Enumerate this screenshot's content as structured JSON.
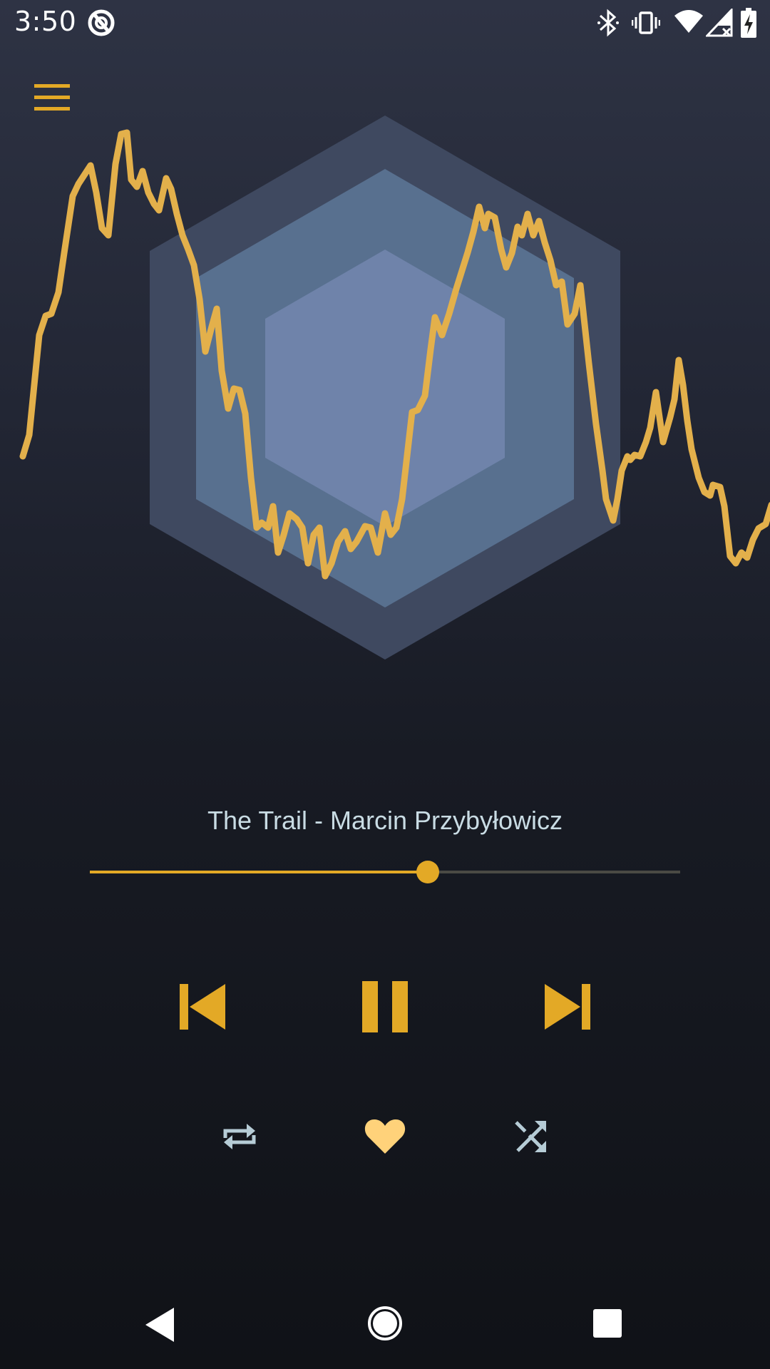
{
  "status_bar": {
    "time": "3:50",
    "icons": [
      "do-not-disturb-icon",
      "bluetooth-icon",
      "vibrate-icon",
      "wifi-icon",
      "cellular-no-data-icon",
      "battery-charging-icon"
    ]
  },
  "header": {
    "menu_icon": "hamburger-menu-icon"
  },
  "player": {
    "track_title": "The Trail - Marcin Przybyłowicz",
    "progress": 0.572,
    "controls": {
      "previous_icon": "skip-previous-icon",
      "play_pause_icon": "pause-icon",
      "next_icon": "skip-next-icon",
      "repeat_icon": "repeat-icon",
      "favorite_icon": "heart-icon",
      "shuffle_icon": "shuffle-icon"
    }
  },
  "navigation": {
    "back_icon": "back-triangle-icon",
    "home_icon": "home-circle-icon",
    "recents_icon": "recents-square-icon"
  },
  "colors": {
    "accent": "#e3a926",
    "waveform": "#e3b04b",
    "favorite": "#ffd27a",
    "secondary_icon": "#b6ccd6",
    "hex_outer": "#3f4960",
    "hex_middle": "#58708f",
    "hex_inner": "#6f83aa"
  }
}
